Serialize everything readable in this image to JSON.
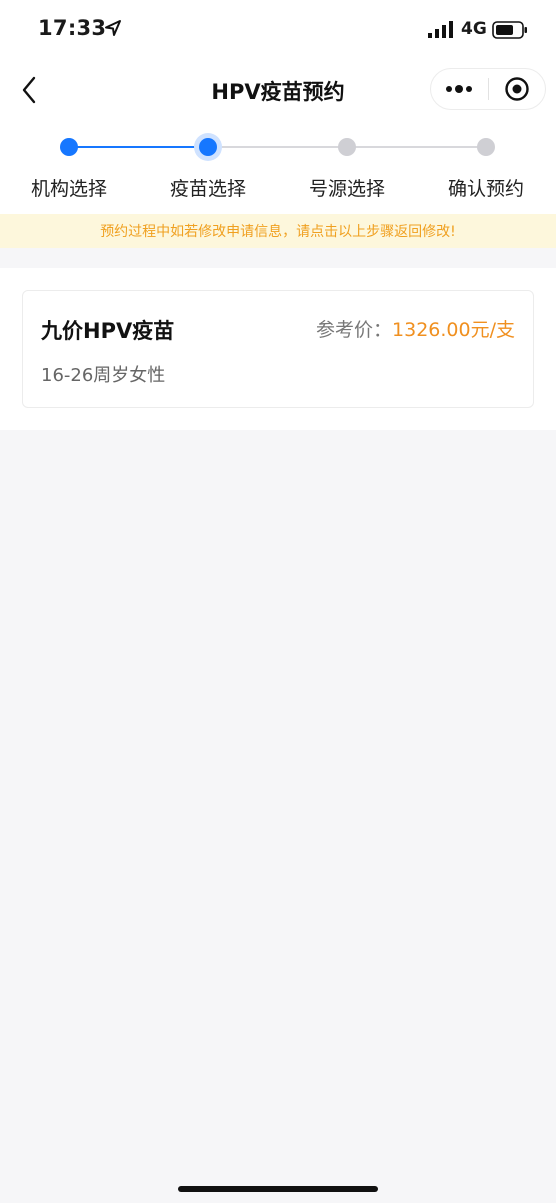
{
  "status_bar": {
    "time": "17:33",
    "network": "4G",
    "location_icon": "location-arrow-icon",
    "signal_icon": "signal-icon",
    "battery_icon": "battery-icon"
  },
  "nav": {
    "title": "HPV疫苗预约",
    "back_icon": "chevron-left-icon",
    "more_icon": "more-dots-icon",
    "target_icon": "target-icon"
  },
  "steps": [
    {
      "label": "机构选择",
      "status": "done"
    },
    {
      "label": "疫苗选择",
      "status": "current"
    },
    {
      "label": "号源选择",
      "status": "pending"
    },
    {
      "label": "确认预约",
      "status": "pending"
    }
  ],
  "notice": {
    "text": "预约过程中如若修改申请信息，请点击以上步骤返回修改!"
  },
  "vaccine_card": {
    "name": "九价HPV疫苗",
    "audience": "16-26周岁女性",
    "price_label": "参考价：",
    "price_value": "1326.00元/支"
  },
  "colors": {
    "accent_blue": "#1677ff",
    "pending_gray": "#cfcfd4",
    "price_orange": "#f09020",
    "notice_bg": "#fdf7dc",
    "notice_text": "#f0a020"
  }
}
